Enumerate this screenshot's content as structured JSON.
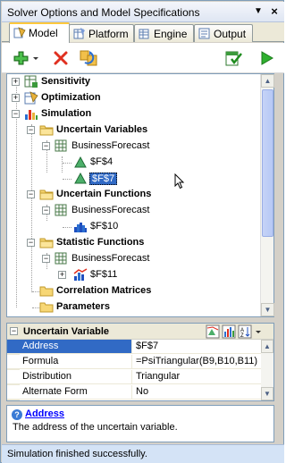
{
  "window": {
    "title": "Solver Options and Model Specifications",
    "pin_glyph": "▼",
    "close_glyph": "×"
  },
  "tabs": [
    {
      "label": "Model",
      "active": true
    },
    {
      "label": "Platform",
      "active": false
    },
    {
      "label": "Engine",
      "active": false
    },
    {
      "label": "Output",
      "active": false
    }
  ],
  "toolbar": {
    "add_icon": "add-icon",
    "delete_icon": "delete-icon",
    "refresh_icon": "refresh-icon",
    "analyze_icon": "analyze-icon",
    "solve_icon": "solve-icon"
  },
  "tree": {
    "sensitivity": "Sensitivity",
    "optimization": "Optimization",
    "simulation": "Simulation",
    "uncertain_variables": "Uncertain Variables",
    "uv_sheet": "BusinessForecast",
    "uv_item1": "$F$4",
    "uv_item2": "$F$7",
    "uncertain_functions": "Uncertain Functions",
    "uf_sheet": "BusinessForecast",
    "uf_item1": "$F$10",
    "statistic_functions": "Statistic Functions",
    "sf_sheet": "BusinessForecast",
    "sf_item1": "$F$11",
    "correlation_matrices": "Correlation Matrices",
    "parameters": "Parameters"
  },
  "properties": {
    "category": "Uncertain Variable",
    "rows": [
      {
        "name": "Address",
        "value": "$F$7"
      },
      {
        "name": "Formula",
        "value": "=PsiTriangular(B9,B10,B11)"
      },
      {
        "name": "Distribution",
        "value": "Triangular"
      },
      {
        "name": "Alternate Form",
        "value": "No"
      }
    ]
  },
  "description": {
    "title": "Address",
    "text": "The address of the uncertain variable."
  },
  "status": {
    "text": "Simulation finished successfully."
  },
  "colors": {
    "selection": "#316ac5",
    "tab_highlight": "#ffc83c",
    "status_bg": "#d4e3f6"
  }
}
